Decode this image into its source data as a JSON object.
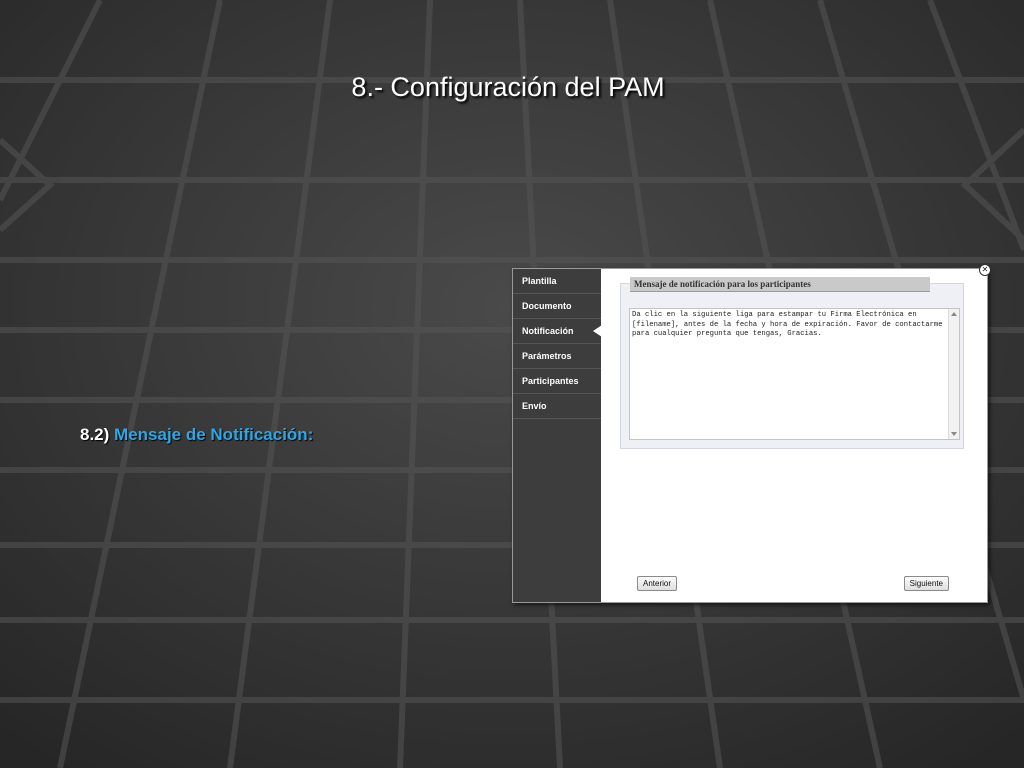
{
  "slide": {
    "title": "8.- Configuración del PAM",
    "subtitle_prefix": "8.2)",
    "subtitle_highlight": "Mensaje de Notificación:"
  },
  "sidebar": {
    "items": [
      {
        "label": "Plantilla"
      },
      {
        "label": "Documento"
      },
      {
        "label": "Notificación"
      },
      {
        "label": "Parámetros"
      },
      {
        "label": "Participantes"
      },
      {
        "label": "Envío"
      }
    ],
    "active_item": "Notificación"
  },
  "panel": {
    "header": "Mensaje de notificación para los participantes",
    "message": "Da clic en la siguiente liga para estampar tu Firma Electrónica en [filename], antes de la fecha y hora de expiración. Favor de contactarme para cualquier pregunta que tengas, Gracias."
  },
  "buttons": {
    "previous": "Anterior",
    "next": "Siguiente"
  },
  "icons": {
    "close": "close-icon",
    "active_indicator": "caret-left-icon"
  },
  "colors": {
    "background": "#3a3a3a",
    "sidebar": "#3d3d3d",
    "accent": "#2aa8e8",
    "panel_header": "#c9c9c9"
  }
}
